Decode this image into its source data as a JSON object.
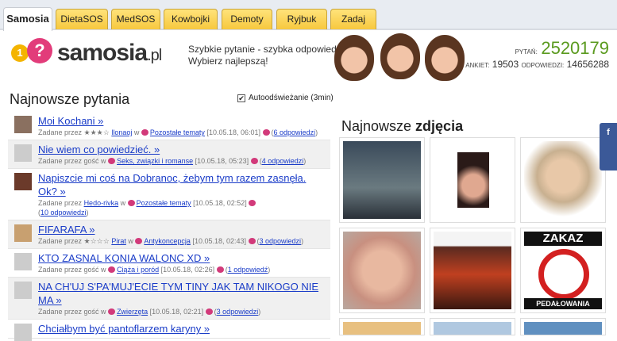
{
  "tabs": [
    "Samosia",
    "DietaSOS",
    "MedSOS",
    "Kowbojki",
    "Demoty",
    "Ryjbuk",
    "Zadaj"
  ],
  "logo": {
    "bubble1": "1",
    "bubble2": "?",
    "name": "samosia",
    "tld": ".pl"
  },
  "slogan": {
    "line1": "Szybkie pytanie - szybka odpowiedź",
    "line2": "Wybierz najlepszą!"
  },
  "stats": {
    "pytan_label": "PYTAŃ:",
    "pytan_value": "2520179",
    "ankiet_label": "ANKIET:",
    "ankiet_value": "19503",
    "odp_label": "ODPOWIEDZI:",
    "odp_value": "14656288"
  },
  "left_heading": "Najnowsze pytania",
  "autorefresh": "Autoodświeżanie (3min)",
  "questions": [
    {
      "title": "Moi Kochani »",
      "prefix": "Zadane przez",
      "user": "llonaoj",
      "w": "w",
      "cat": "Pozostałe tematy",
      "date": "[10.05.18, 06:01]",
      "answers": "6 odpowiedzi"
    },
    {
      "title": "Nie wiem co powiedzieć. »",
      "prefix": "Zadane przez gość w",
      "user": "",
      "w": "",
      "cat": "Seks, związki i romanse",
      "date": "[10.05.18, 05:23]",
      "answers": "4 odpowiedzi"
    },
    {
      "title": "Napiszcie mi coś na Dobranoc, żebym tym razem zasnęła. Ok? »",
      "prefix": "Zadane przez",
      "user": "Hedo-rivka",
      "w": "w",
      "cat": "Pozostałe tematy",
      "date": "[10.05.18, 02:52]",
      "answers": "10 odpowiedzi"
    },
    {
      "title": "FIFARAFA »",
      "prefix": "Zadane przez",
      "user": "Pirat",
      "w": "w",
      "cat": "Antykoncepcja",
      "date": "[10.05.18, 02:43]",
      "answers": "3 odpowiedzi"
    },
    {
      "title": "KTO ZASNAL KONIA WALONC XD »",
      "prefix": "Zadane przez gość w",
      "user": "",
      "w": "",
      "cat": "Ciąża i poród",
      "date": "[10.05.18, 02:26]",
      "answers": "1 odpowiedź"
    },
    {
      "title": "NA CH'UJ S'PA'MUJ'ECIE TYM TINY JAK TAM NIKOGO NIE MA »",
      "prefix": "Zadane przez gość w",
      "user": "",
      "w": "",
      "cat": "Zwierzęta",
      "date": "[10.05.18, 02:21]",
      "answers": "3 odpowiedzi"
    },
    {
      "title": "Chciałbym być pantoflarzem karyny »",
      "prefix": "",
      "user": "",
      "w": "",
      "cat": "",
      "date": "",
      "answers": ""
    }
  ],
  "right_heading": {
    "a": "Najnowsze ",
    "b": "zdjęcia"
  },
  "thumb_texts": {
    "zakaz": "ZAKAZ",
    "pedal": "PEDAŁOWANIA"
  },
  "fb_label": "f"
}
